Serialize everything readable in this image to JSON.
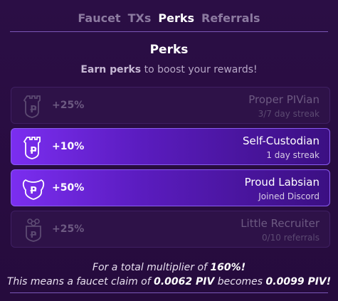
{
  "tabs": [
    {
      "label": "Faucet",
      "active": false
    },
    {
      "label": "TXs",
      "active": false
    },
    {
      "label": "Perks",
      "active": true
    },
    {
      "label": "Referrals",
      "active": false
    }
  ],
  "page": {
    "title": "Perks",
    "subtitle_bold": "Earn perks",
    "subtitle_rest": " to boost your rewards!"
  },
  "perks": [
    {
      "bonus": "+25%",
      "name": "Proper PIVian",
      "detail": "3/7 day streak",
      "state": "inactive",
      "icon": "castle-badge-icon"
    },
    {
      "bonus": "+10%",
      "name": "Self-Custodian",
      "detail": "1 day streak",
      "state": "active",
      "icon": "castle-badge-icon"
    },
    {
      "bonus": "+50%",
      "name": "Proud Labsian",
      "detail": "Joined Discord",
      "state": "active",
      "icon": "crest-badge-icon"
    },
    {
      "bonus": "+25%",
      "name": "Little Recruiter",
      "detail": "0/10 referrals",
      "state": "inactive",
      "icon": "group-badge-icon"
    }
  ],
  "summary": {
    "line1_prefix": "For a total multiplier of ",
    "line1_value": "160%!",
    "line2_prefix": "This means a faucet claim of ",
    "line2_claim": "0.0062 PIV",
    "line2_mid": " becomes ",
    "line2_result": "0.0099 PIV!"
  },
  "colors": {
    "background": "#2a0d42",
    "active_card": "#7b2ef0",
    "inactive_text": "#6d5a82",
    "rule": "#7b56b8"
  }
}
